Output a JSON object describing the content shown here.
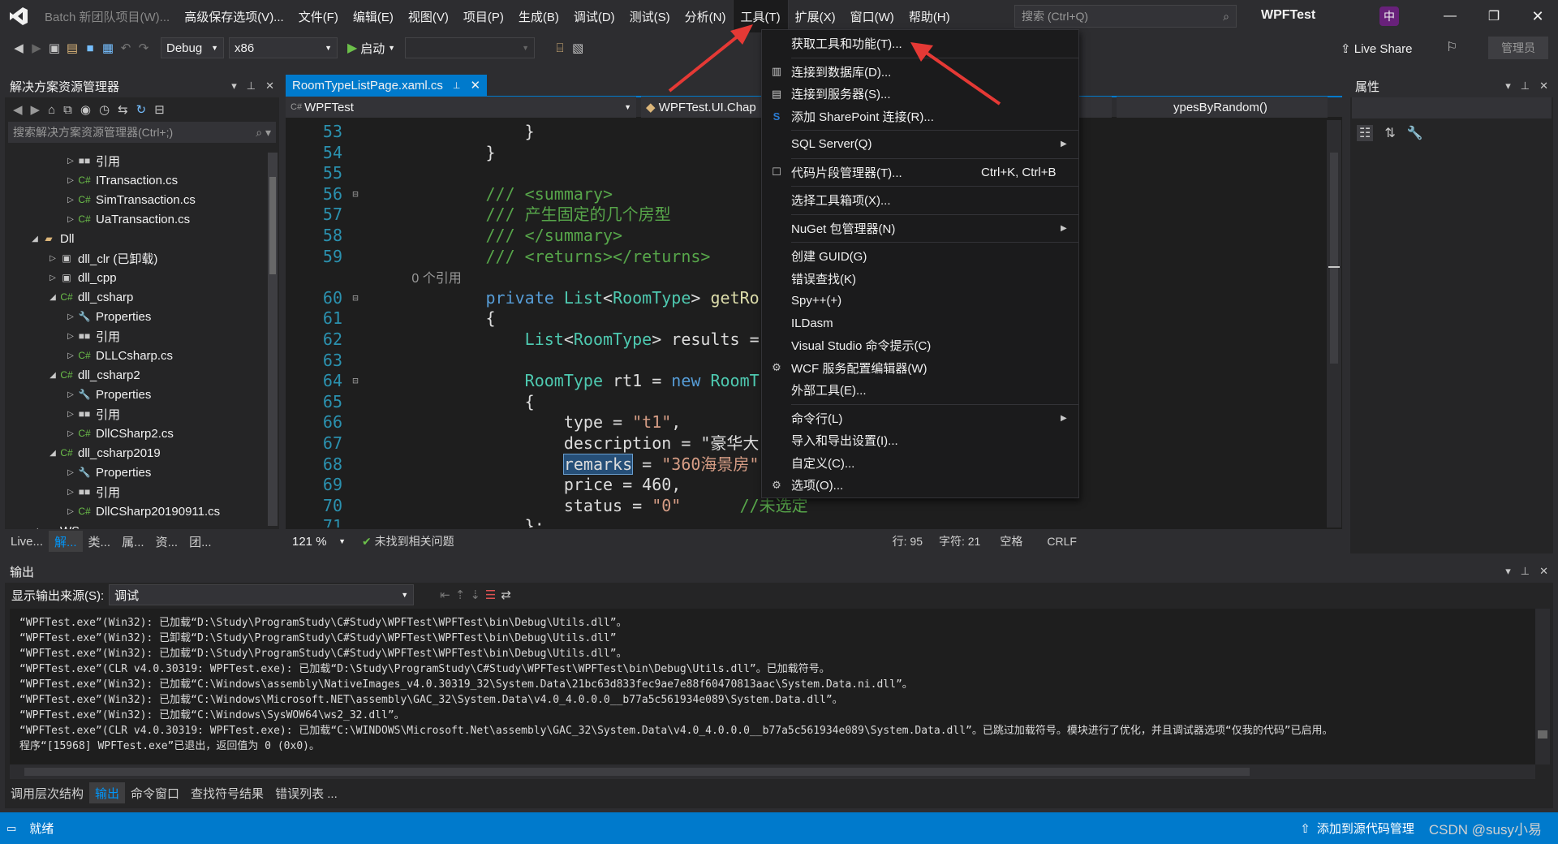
{
  "window": {
    "title": "Batch 新团队项目(W)...",
    "solution_name": "WPFTest",
    "ime": "中",
    "min_icon": "minimize-icon",
    "max_icon": "restore-icon",
    "close_icon": "close-icon"
  },
  "menubar": {
    "items": [
      "高级保存选项(V)...",
      "文件(F)",
      "编辑(E)",
      "视图(V)",
      "项目(P)",
      "生成(B)",
      "调试(D)",
      "测试(S)",
      "分析(N)",
      "工具(T)",
      "扩展(X)",
      "窗口(W)",
      "帮助(H)"
    ],
    "active": "工具(T)"
  },
  "search": {
    "placeholder": "搜索 (Ctrl+Q)"
  },
  "toolbar": {
    "config": "Debug",
    "platform": "x86",
    "start_label": "启动",
    "live_share": "Live Share",
    "admin": "管理员"
  },
  "solution_explorer": {
    "title": "解决方案资源管理器",
    "search_placeholder": "搜索解决方案资源管理器(Ctrl+;)",
    "items": [
      {
        "label": "引用",
        "indent": 3,
        "exp": "collapsed",
        "icon": "ref"
      },
      {
        "label": "ITransaction.cs",
        "indent": 3,
        "exp": "collapsed",
        "icon": "cs"
      },
      {
        "label": "SimTransaction.cs",
        "indent": 3,
        "exp": "collapsed",
        "icon": "cs"
      },
      {
        "label": "UaTransaction.cs",
        "indent": 3,
        "exp": "collapsed",
        "icon": "cs"
      },
      {
        "label": "Dll",
        "indent": 1,
        "exp": "expanded",
        "icon": "folder"
      },
      {
        "label": "dll_clr (已卸载)",
        "indent": 2,
        "exp": "collapsed",
        "icon": "proj"
      },
      {
        "label": "dll_cpp",
        "indent": 2,
        "exp": "collapsed",
        "icon": "proj"
      },
      {
        "label": "dll_csharp",
        "indent": 2,
        "exp": "expanded",
        "icon": "csproj"
      },
      {
        "label": "Properties",
        "indent": 3,
        "exp": "collapsed",
        "icon": "wrench"
      },
      {
        "label": "引用",
        "indent": 3,
        "exp": "collapsed",
        "icon": "ref"
      },
      {
        "label": "DLLCsharp.cs",
        "indent": 3,
        "exp": "collapsed",
        "icon": "cs"
      },
      {
        "label": "dll_csharp2",
        "indent": 2,
        "exp": "expanded",
        "icon": "csproj"
      },
      {
        "label": "Properties",
        "indent": 3,
        "exp": "collapsed",
        "icon": "wrench"
      },
      {
        "label": "引用",
        "indent": 3,
        "exp": "collapsed",
        "icon": "ref"
      },
      {
        "label": "DllCSharp2.cs",
        "indent": 3,
        "exp": "collapsed",
        "icon": "cs"
      },
      {
        "label": "dll_csharp2019",
        "indent": 2,
        "exp": "expanded",
        "icon": "csproj"
      },
      {
        "label": "Properties",
        "indent": 3,
        "exp": "collapsed",
        "icon": "wrench"
      },
      {
        "label": "引用",
        "indent": 3,
        "exp": "collapsed",
        "icon": "ref"
      },
      {
        "label": "DllCSharp20190911.cs",
        "indent": 3,
        "exp": "collapsed",
        "icon": "cs"
      },
      {
        "label": "WS",
        "indent": 1,
        "exp": "expanded",
        "icon": "folder"
      }
    ],
    "bottom_tabs": [
      "Live...",
      "解...",
      "类...",
      "属...",
      "资...",
      "团..."
    ]
  },
  "editor": {
    "tab_label": "RoomTypeListPage.xaml.cs",
    "nav_project": "WPFTest",
    "nav_class": "WPFTest.UI.Chap",
    "nav_member": "ypesByRandom()",
    "zoom": "121 %",
    "issues": "未找到相关问题",
    "line": "行: 95",
    "col": "字符: 21",
    "spaces": "空格",
    "eol": "CRLF",
    "lines": [
      {
        "n": "53",
        "t": "                }"
      },
      {
        "n": "54",
        "t": "            }"
      },
      {
        "n": "55",
        "t": ""
      },
      {
        "n": "56",
        "t": "            /// <summary>",
        "c": "comment"
      },
      {
        "n": "57",
        "t": "            /// 产生固定的几个房型",
        "c": "comment"
      },
      {
        "n": "58",
        "t": "            /// </summary>",
        "c": "comment"
      },
      {
        "n": "59",
        "t": "            /// <returns></returns>",
        "c": "comment"
      },
      {
        "n": "",
        "t": "            0 个引用",
        "c": "lens"
      },
      {
        "n": "60",
        "t": "            private List<RoomType> getRo",
        "c": "decl"
      },
      {
        "n": "61",
        "t": "            {"
      },
      {
        "n": "62",
        "t": "                List<RoomType> results = ",
        "c": "decl2"
      },
      {
        "n": "63",
        "t": ""
      },
      {
        "n": "64",
        "t": "                RoomType rt1 = new RoomT",
        "c": "decl3"
      },
      {
        "n": "65",
        "t": "                {"
      },
      {
        "n": "66",
        "t": "                    type = \"t1\",",
        "c": "str"
      },
      {
        "n": "67",
        "t": "                    description = \"豪华大",
        "c": "str"
      },
      {
        "n": "68",
        "t": "                    remarks = \"360海景房\"",
        "c": "str"
      },
      {
        "n": "69",
        "t": "                    price = 460,"
      },
      {
        "n": "70",
        "t": "                    status = \"0\"      //未选定",
        "c": "str"
      },
      {
        "n": "71",
        "t": "                };"
      }
    ]
  },
  "tools_menu": {
    "items": [
      {
        "label": "获取工具和功能(T)...",
        "icon": ""
      },
      {
        "sep": true
      },
      {
        "label": "连接到数据库(D)...",
        "icon": "db"
      },
      {
        "label": "连接到服务器(S)...",
        "icon": "srv"
      },
      {
        "label": "添加 SharePoint 连接(R)...",
        "icon": "sp"
      },
      {
        "sep": true
      },
      {
        "label": "SQL Server(Q)",
        "sub": true
      },
      {
        "sep": true
      },
      {
        "label": "代码片段管理器(T)...",
        "icon": "box",
        "shortcut": "Ctrl+K, Ctrl+B"
      },
      {
        "sep": true
      },
      {
        "label": "选择工具箱项(X)..."
      },
      {
        "sep": true
      },
      {
        "label": "NuGet 包管理器(N)",
        "sub": true
      },
      {
        "sep": true
      },
      {
        "label": "创建 GUID(G)"
      },
      {
        "label": "错误查找(K)"
      },
      {
        "label": "Spy++(+)"
      },
      {
        "label": "ILDasm"
      },
      {
        "label": "Visual Studio 命令提示(C)"
      },
      {
        "label": "WCF 服务配置编辑器(W)",
        "icon": "gear2"
      },
      {
        "label": "外部工具(E)..."
      },
      {
        "sep": true
      },
      {
        "label": "命令行(L)",
        "sub": true
      },
      {
        "label": "导入和导出设置(I)..."
      },
      {
        "label": "自定义(C)..."
      },
      {
        "label": "选项(O)...",
        "icon": "gear"
      }
    ]
  },
  "properties": {
    "title": "属性"
  },
  "output": {
    "title": "输出",
    "source_label": "显示输出来源(S):",
    "source_value": "调试",
    "lines": [
      "“WPFTest.exe”(Win32): 已加载“D:\\Study\\ProgramStudy\\C#Study\\WPFTest\\WPFTest\\bin\\Debug\\Utils.dll”。",
      "“WPFTest.exe”(Win32): 已卸载“D:\\Study\\ProgramStudy\\C#Study\\WPFTest\\WPFTest\\bin\\Debug\\Utils.dll”",
      "“WPFTest.exe”(Win32): 已加载“D:\\Study\\ProgramStudy\\C#Study\\WPFTest\\WPFTest\\bin\\Debug\\Utils.dll”。",
      "“WPFTest.exe”(CLR v4.0.30319: WPFTest.exe): 已加载“D:\\Study\\ProgramStudy\\C#Study\\WPFTest\\WPFTest\\bin\\Debug\\Utils.dll”。已加载符号。",
      "“WPFTest.exe”(Win32): 已加载“C:\\Windows\\assembly\\NativeImages_v4.0.30319_32\\System.Data\\21bc63d833fec9ae7e88f60470813aac\\System.Data.ni.dll”。",
      "“WPFTest.exe”(Win32): 已加载“C:\\Windows\\Microsoft.NET\\assembly\\GAC_32\\System.Data\\v4.0_4.0.0.0__b77a5c561934e089\\System.Data.dll”。",
      "“WPFTest.exe”(Win32): 已加载“C:\\Windows\\SysWOW64\\ws2_32.dll”。",
      "“WPFTest.exe”(CLR v4.0.30319: WPFTest.exe): 已加载“C:\\WINDOWS\\Microsoft.Net\\assembly\\GAC_32\\System.Data\\v4.0_4.0.0.0__b77a5c561934e089\\System.Data.dll”。已跳过加载符号。模块进行了优化，并且调试器选项“仅我的代码”已启用。",
      "程序“[15968] WPFTest.exe”已退出，返回值为 0 (0x0)。"
    ],
    "bottom_tabs": [
      "调用层次结构",
      "输出",
      "命令窗口",
      "查找符号结果",
      "错误列表 ..."
    ],
    "selected_tab": "输出"
  },
  "statusbar": {
    "ready": "就绪",
    "source_control": "添加到源代码管理",
    "watermark": "CSDN @susy小易"
  },
  "colors": {
    "accent": "#007acc",
    "arrow": "#e53935",
    "keyword": "#569cd6",
    "comment": "#57a64a",
    "string": "#d69d85",
    "type": "#4ec9b0"
  }
}
